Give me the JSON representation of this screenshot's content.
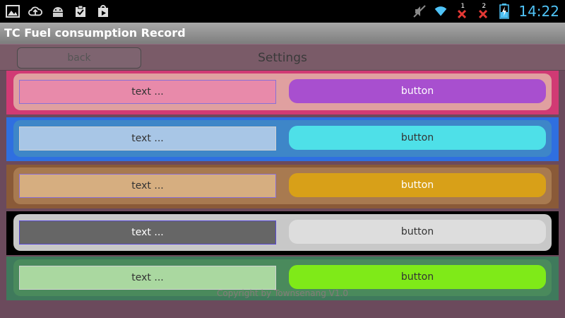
{
  "status_bar": {
    "time": "14:22",
    "left_icons": [
      "gallery-icon",
      "cloud-upload-icon",
      "android-icon",
      "clipboard-check-icon",
      "play-store-icon"
    ],
    "right_icons": [
      "mute-icon",
      "wifi-icon",
      "signal-1-icon",
      "signal-2-icon",
      "battery-icon"
    ],
    "sim1": "1",
    "sim2": "2"
  },
  "app": {
    "title": "TC Fuel consumption Record"
  },
  "header": {
    "back_label": "back",
    "title": "Settings"
  },
  "rows": [
    {
      "text": "text ...",
      "button": "button",
      "row_bg": "#d13a74",
      "card_bg": "#e0a0a0",
      "text_bg": "#e88aaa",
      "text_border": "#8a6fd6",
      "text_color": "#333333",
      "btn_bg": "#a84fcf",
      "btn_color": "#ffffff"
    },
    {
      "text": "text ...",
      "button": "button",
      "row_bg": "#2f6fe0",
      "card_bg": "#3e86c8",
      "text_bg": "#a8c6e6",
      "text_border": "#d0d0d0",
      "text_color": "#333333",
      "btn_bg": "#4ee0e8",
      "btn_color": "#333333"
    },
    {
      "text": "text ...",
      "button": "button",
      "row_bg": "#8a5a38",
      "card_bg": "#a87a50",
      "text_bg": "#d6ae80",
      "text_border": "#8a6fd6",
      "text_color": "#333333",
      "btn_bg": "#d8a018",
      "btn_color": "#ffffff"
    },
    {
      "text": "text ...",
      "button": "button",
      "row_bg": "#000000",
      "card_bg": "#c8c8c8",
      "text_bg": "#666666",
      "text_border": "#5a4ad6",
      "text_color": "#ffffff",
      "btn_bg": "#dddddd",
      "btn_color": "#333333"
    },
    {
      "text": "text ...",
      "button": "button",
      "row_bg": "#3f7a5c",
      "card_bg": "#4a8a5c",
      "text_bg": "#aad8a0",
      "text_border": "#d0d0d0",
      "text_color": "#333333",
      "btn_bg": "#7fea18",
      "btn_color": "#333333"
    }
  ],
  "footer": {
    "copyright": "Copyright by Townsenang V1.0"
  }
}
